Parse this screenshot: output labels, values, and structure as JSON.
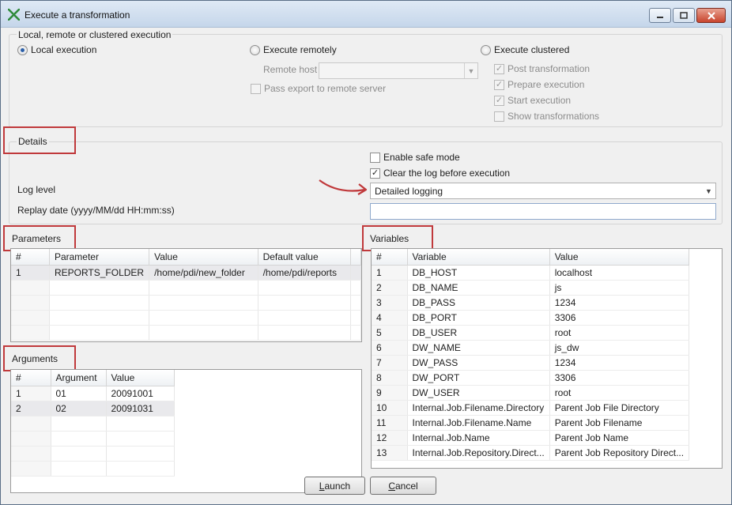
{
  "window": {
    "title": "Execute a transformation"
  },
  "execution": {
    "group_title": "Local, remote or clustered execution",
    "local_label": "Local execution",
    "remote_label": "Execute remotely",
    "remote_host_label": "Remote host",
    "remote_host_value": "",
    "pass_export_label": "Pass export to remote server",
    "clustered_label": "Execute clustered",
    "post_transformation_label": "Post transformation",
    "prepare_execution_label": "Prepare execution",
    "start_execution_label": "Start execution",
    "show_transformations_label": "Show transformations"
  },
  "details": {
    "group_title": "Details",
    "safe_mode_label": "Enable safe mode",
    "clear_log_label": "Clear the log before execution",
    "log_level_label": "Log level",
    "log_level_value": "Detailed logging",
    "replay_date_label": "Replay date (yyyy/MM/dd HH:mm:ss)",
    "replay_date_value": ""
  },
  "parameters": {
    "title": "Parameters",
    "columns": [
      "#",
      "Parameter",
      "Value",
      "Default value"
    ],
    "rows": [
      [
        "1",
        "REPORTS_FOLDER",
        "/home/pdi/new_folder",
        "/home/pdi/reports"
      ]
    ]
  },
  "arguments": {
    "title": "Arguments",
    "columns": [
      "#",
      "Argument",
      "Value"
    ],
    "rows": [
      [
        "1",
        "01",
        "20091001"
      ],
      [
        "2",
        "02",
        "20091031"
      ]
    ]
  },
  "variables": {
    "title": "Variables",
    "columns": [
      "#",
      "Variable",
      "Value"
    ],
    "rows": [
      [
        "1",
        "DB_HOST",
        "localhost"
      ],
      [
        "2",
        "DB_NAME",
        "js"
      ],
      [
        "3",
        "DB_PASS",
        "1234"
      ],
      [
        "4",
        "DB_PORT",
        "3306"
      ],
      [
        "5",
        "DB_USER",
        "root"
      ],
      [
        "6",
        "DW_NAME",
        "js_dw"
      ],
      [
        "7",
        "DW_PASS",
        "1234"
      ],
      [
        "8",
        "DW_PORT",
        "3306"
      ],
      [
        "9",
        "DW_USER",
        "root"
      ],
      [
        "10",
        "Internal.Job.Filename.Directory",
        "Parent Job File Directory"
      ],
      [
        "11",
        "Internal.Job.Filename.Name",
        "Parent Job Filename"
      ],
      [
        "12",
        "Internal.Job.Name",
        "Parent Job Name"
      ],
      [
        "13",
        "Internal.Job.Repository.Direct...",
        "Parent Job Repository Direct..."
      ]
    ]
  },
  "buttons": {
    "launch_prefix": "L",
    "launch_rest": "aunch",
    "cancel_prefix": "C",
    "cancel_rest": "ancel"
  },
  "colors": {
    "highlight": "#c0393b",
    "accent": "#2b5fa8"
  }
}
